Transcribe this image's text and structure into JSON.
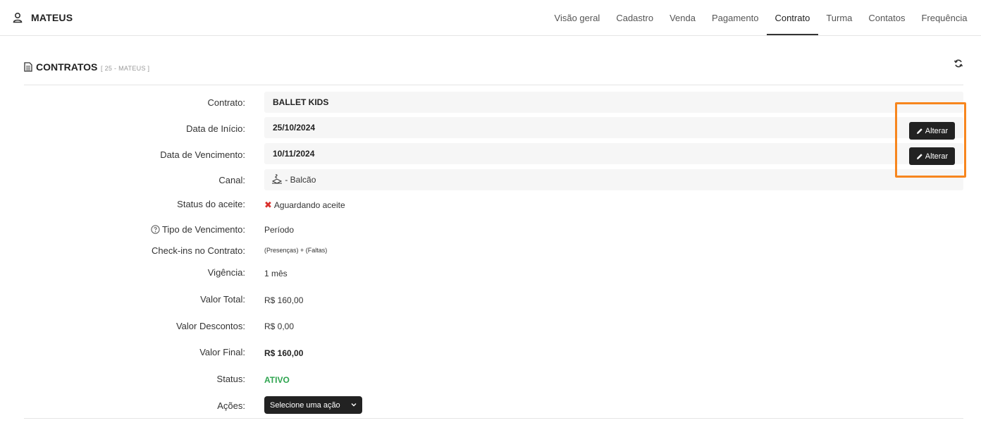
{
  "user": {
    "name": "MATEUS",
    "icon": "user-icon"
  },
  "tabs": [
    {
      "label": "Visão geral"
    },
    {
      "label": "Cadastro"
    },
    {
      "label": "Venda"
    },
    {
      "label": "Pagamento"
    },
    {
      "label": "Contrato",
      "active": true
    },
    {
      "label": "Turma"
    },
    {
      "label": "Contatos"
    },
    {
      "label": "Frequência"
    }
  ],
  "section": {
    "title": "CONTRATOS",
    "subtitle": "[ 25 - MATEUS ]"
  },
  "fields": {
    "contrato": {
      "label": "Contrato:",
      "value": "BALLET KIDS"
    },
    "data_inicio": {
      "label": "Data de Início:",
      "value": "25/10/2024"
    },
    "data_vencimento": {
      "label": "Data de Vencimento:",
      "value": "10/11/2024"
    },
    "canal": {
      "label": "Canal:",
      "value": "- Balcão",
      "icon": "counter-icon"
    },
    "status_aceite": {
      "label": "Status do aceite:",
      "value": "Aguardando aceite",
      "icon": "x-icon"
    },
    "tipo_vencimento": {
      "label": "Tipo de Vencimento:",
      "value": "Período",
      "icon": "help-icon"
    },
    "checkins": {
      "label": "Check-ins no Contrato:",
      "value": "(Presenças) + (Faltas)"
    },
    "vigencia": {
      "label": "Vigência:",
      "value": "1 mês"
    },
    "valor_total": {
      "label": "Valor Total:",
      "value": "R$ 160,00"
    },
    "valor_descontos": {
      "label": "Valor Descontos:",
      "value": "R$ 0,00"
    },
    "valor_final": {
      "label": "Valor Final:",
      "value": "R$ 160,00"
    },
    "status": {
      "label": "Status:",
      "value": "ATIVO"
    },
    "acoes": {
      "label": "Ações:",
      "value": "Selecione uma ação"
    }
  },
  "buttons": {
    "alterar_label": "Alterar"
  },
  "colors": {
    "highlight": "#f7861e",
    "active_status": "#2ea44f",
    "dark_button": "#222222"
  }
}
